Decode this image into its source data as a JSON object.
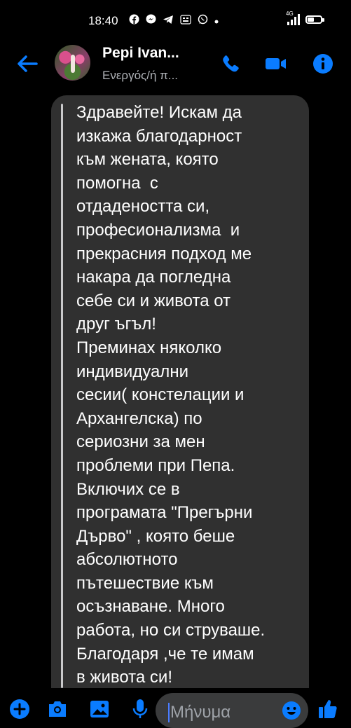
{
  "status_bar": {
    "time": "18:40",
    "notif_icons": [
      "facebook-icon",
      "messenger-icon",
      "telegram-icon",
      "game-badge-icon",
      "whatsapp-icon",
      "dot-icon"
    ],
    "network": "4G"
  },
  "header": {
    "contact_name": "Pepi Ivan...",
    "status": "Ενεργός/ή π..."
  },
  "message": {
    "text": "Здравейте! Искам да\nизкажа благодарност\nкъм жената, която\nпомогна  с\nотдадеността си,\nпрофесионализма  и\nпрекрасния подход ме\nнакара да погледна\nсебе си и живота от\nдруг ъгъл!\nПреминах няколко\nиндивидуални\nсесии( констелации и\nАрхангелска) по\nсериозни за мен\nпроблеми при Пепа.\nВключих се в\nпрограмата \"Прегърни\nДърво\" , която беше\nабсолютното\nпътешествие към\nосъзнаване. Много\nработа, но си струваше.\nБлагодаря ,че те имам\nв живота си!"
  },
  "composer": {
    "placeholder": "Μήνυμα"
  },
  "colors": {
    "accent": "#0a7cff",
    "background": "#000000",
    "bubble": "#303030",
    "input": "#3a3b3c"
  }
}
